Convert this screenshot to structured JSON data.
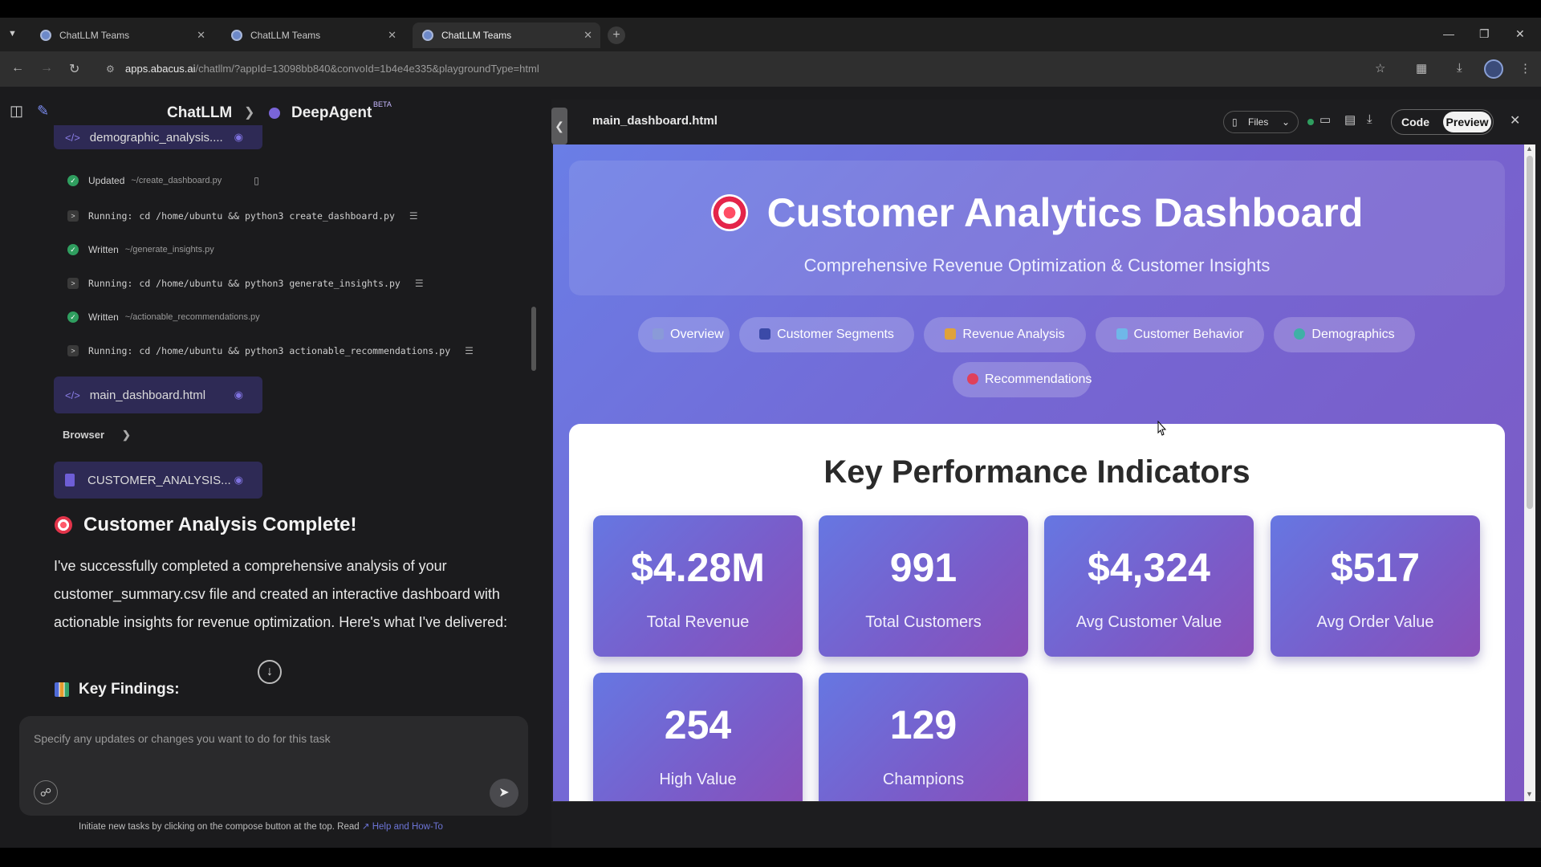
{
  "browser": {
    "tabs": [
      {
        "title": "ChatLLM Teams"
      },
      {
        "title": "ChatLLM Teams"
      },
      {
        "title": "ChatLLM Teams"
      }
    ],
    "url_host": "apps.abacus.ai",
    "url_path": "/chatllm/?appId=13098bb840&convoId=1b4e4e335&playgroundType=html"
  },
  "left": {
    "breadcrumb_app": "ChatLLM",
    "breadcrumb_agent": "DeepAgent",
    "beta": "BETA",
    "top_chip": "demographic_analysis....",
    "logs": [
      {
        "label": "Updated",
        "path": "~/create_dashboard.py"
      },
      {
        "label": "Running:",
        "cmd": "cd /home/ubuntu && python3 create_dashboard.py"
      },
      {
        "label": "Written",
        "path": "~/generate_insights.py"
      },
      {
        "label": "Running:",
        "cmd": "cd /home/ubuntu && python3 generate_insights.py"
      },
      {
        "label": "Written",
        "path": "~/actionable_recommendations.py"
      },
      {
        "label": "Running:",
        "cmd": "cd /home/ubuntu && python3 actionable_recommendations.py"
      }
    ],
    "html_chip": "main_dashboard.html",
    "browser_label": "Browser",
    "md_chip": "CUSTOMER_ANALYSIS...",
    "heading": "Customer Analysis Complete!",
    "paragraph": "I've successfully completed a comprehensive analysis of your customer_summary.csv file and created an interactive dashboard with actionable insights for revenue optimization. Here's what I've delivered:",
    "key_findings": "Key Findings:",
    "composer_placeholder": "Specify any updates or changes you want to do for this task",
    "footnote": "Initiate new tasks by clicking on the compose button at the top. Read",
    "footnote_link": "Help and How-To"
  },
  "right": {
    "filename": "main_dashboard.html",
    "files_label": "Files",
    "code_label": "Code",
    "preview_label": "Preview",
    "dashboard": {
      "title": "Customer Analytics Dashboard",
      "subtitle": "Comprehensive Revenue Optimization & Customer Insights",
      "nav": [
        {
          "label": "Overview",
          "color": "#8a9ad8"
        },
        {
          "label": "Customer Segments",
          "color": "#3b4aa8"
        },
        {
          "label": "Revenue Analysis",
          "color": "#e0a23a"
        },
        {
          "label": "Customer Behavior",
          "color": "#6fb7e8"
        },
        {
          "label": "Demographics",
          "color": "#3fb0a6"
        },
        {
          "label": "Recommendations",
          "color": "#e0405a"
        }
      ],
      "kpi_heading": "Key Performance Indicators",
      "kpis": [
        {
          "value": "$4.28M",
          "label": "Total Revenue"
        },
        {
          "value": "991",
          "label": "Total Customers"
        },
        {
          "value": "$4,324",
          "label": "Avg Customer Value"
        },
        {
          "value": "$517",
          "label": "Avg Order Value"
        },
        {
          "value": "254",
          "label": "High Value"
        },
        {
          "value": "129",
          "label": "Champions"
        }
      ]
    }
  }
}
